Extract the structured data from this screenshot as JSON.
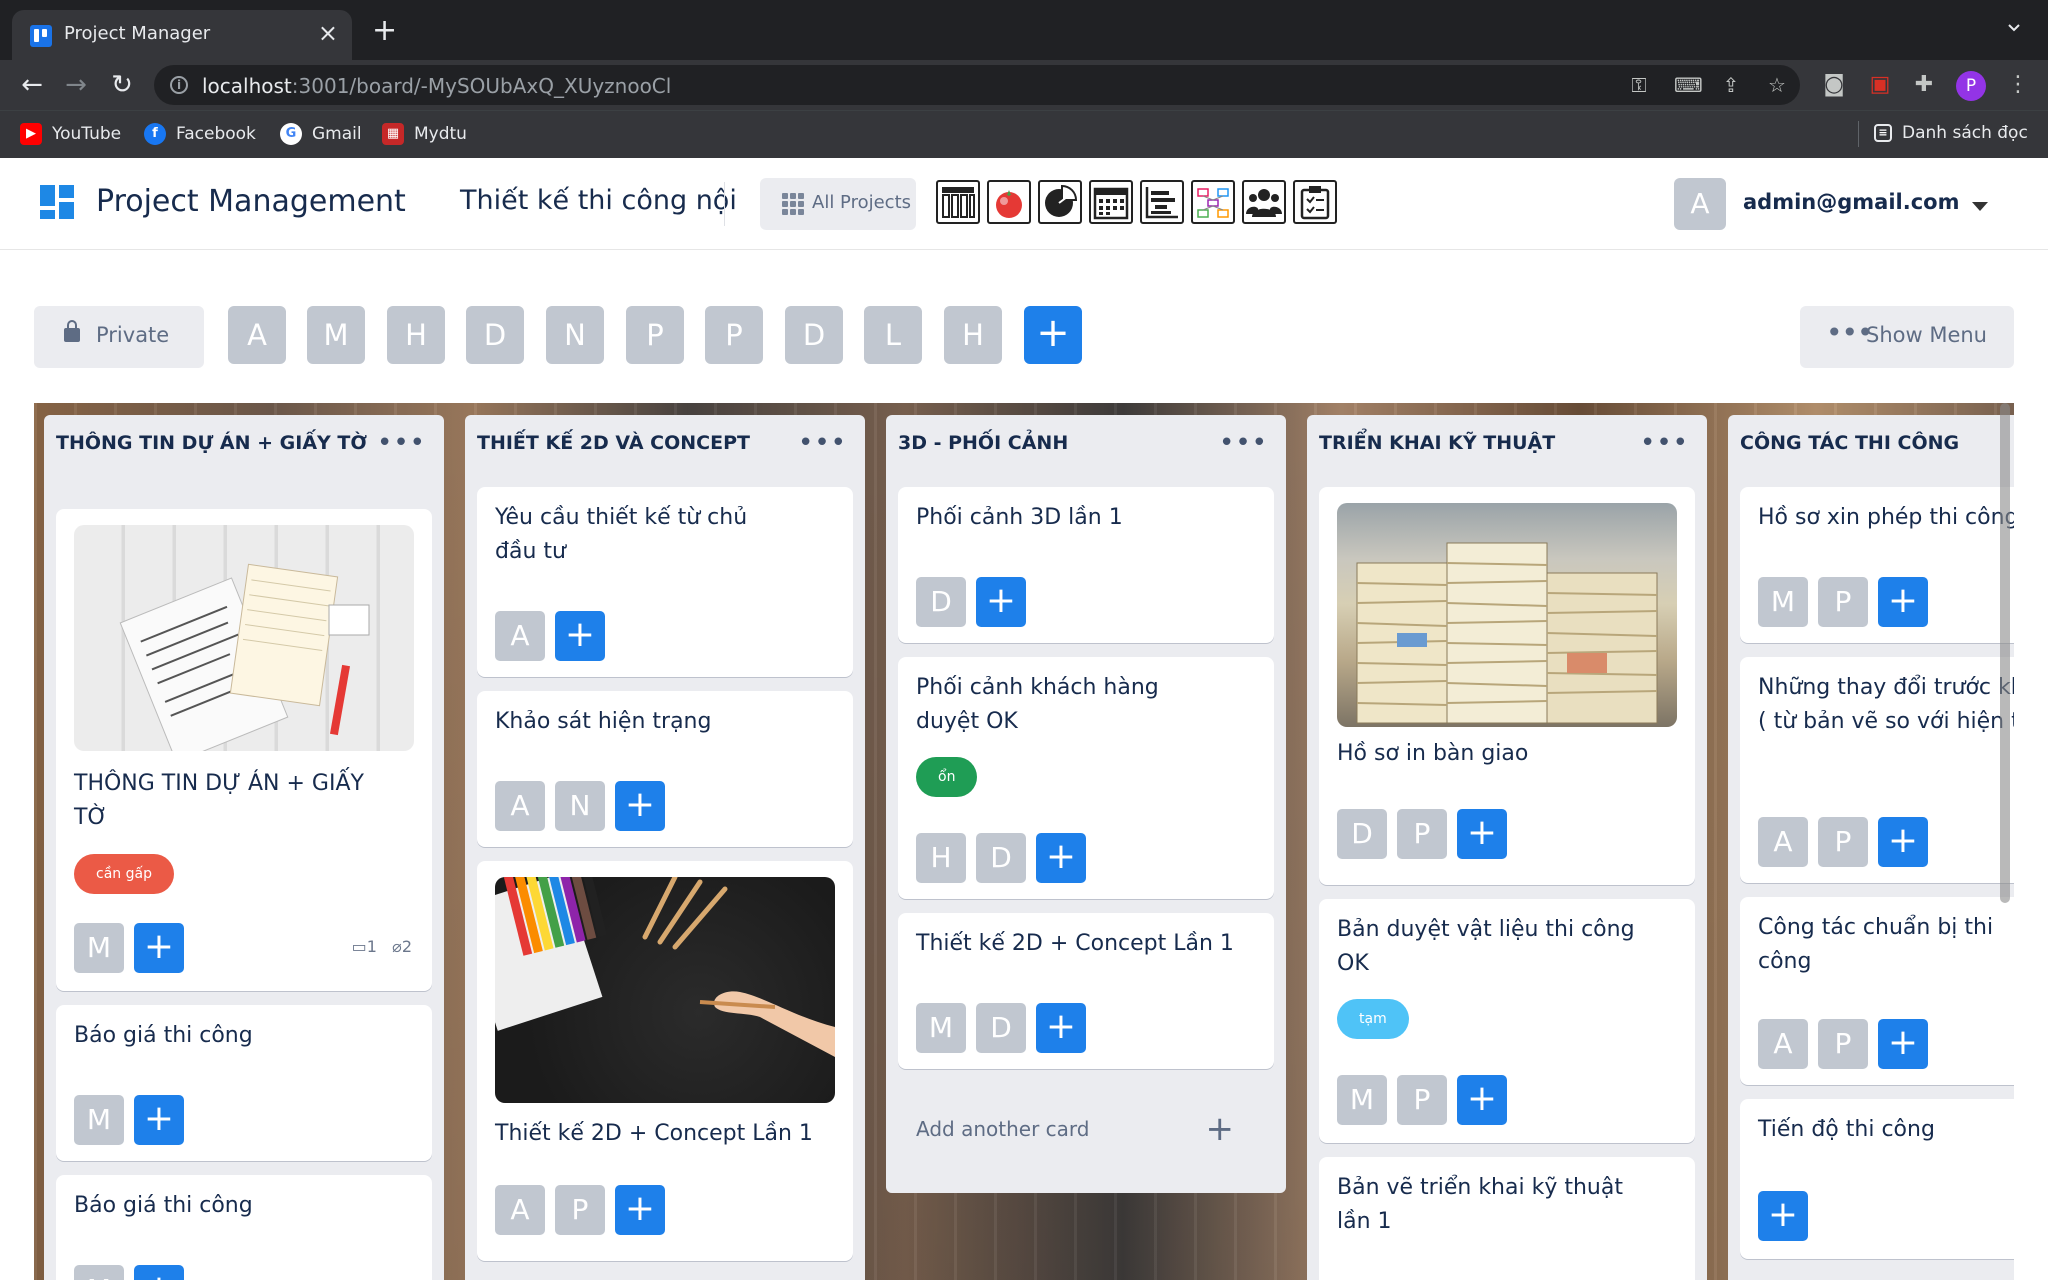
{
  "browser": {
    "tab_title": "Project Manager",
    "url_host": "localhost",
    "url_rest": ":3001/board/-MySOUbAxQ_XUyznooCl",
    "bookmarks": [
      "YouTube",
      "Facebook",
      "Gmail",
      "Mydtu"
    ],
    "reading_list": "Danh sách đọc",
    "profile_initial": "P"
  },
  "app": {
    "title": "Project Management",
    "board_name": "Thiết kế thi công nội",
    "all_projects": "All Projects",
    "user_initial": "A",
    "user_email": "admin@gmail.com"
  },
  "boardbar": {
    "private_label": "Private",
    "members": [
      "A",
      "M",
      "H",
      "D",
      "N",
      "P",
      "P",
      "D",
      "L",
      "H"
    ],
    "add_member": "+",
    "show_menu": "Show Menu"
  },
  "colors": {
    "accent": "#1e80ea",
    "label_red": "#eb5a46",
    "label_green": "#1f9d55",
    "label_cyan": "#4fc3f7"
  },
  "columns": [
    {
      "title": "THÔNG TIN DỰ ÁN + GIẤY TỜ",
      "cards": [
        {
          "title": "THÔNG TIN DỰ ÁN + GIẤY TỜ",
          "image": "documents",
          "label": "cần gấp",
          "members": [
            "M"
          ],
          "comments": "1",
          "attachments": "2"
        },
        {
          "title": "Báo giá thi công",
          "members": [
            "M"
          ]
        },
        {
          "title": "Báo giá thi công",
          "members": []
        }
      ]
    },
    {
      "title": "THIẾT KẾ 2D VÀ CONCEPT",
      "cards": [
        {
          "title": "Yêu cầu thiết kế từ chủ đầu tư",
          "members": [
            "A"
          ]
        },
        {
          "title": "Khảo sát hiện trạng",
          "members": [
            "A",
            "N"
          ]
        },
        {
          "title": "Thiết kế 2D + Concept Lần 1",
          "image": "pencils",
          "members": [
            "A",
            "P"
          ]
        }
      ]
    },
    {
      "title": "3D - PHỐI CẢNH",
      "cards": [
        {
          "title": "Phối cảnh 3D lần 1",
          "members": [
            "D"
          ]
        },
        {
          "title": "Phối cảnh khách hàng duyệt OK",
          "label": "ổn",
          "members": [
            "H",
            "D"
          ]
        },
        {
          "title": "Thiết kế 2D + Concept Lần 1",
          "members": [
            "M",
            "D"
          ]
        }
      ],
      "add_card": "Add another card"
    },
    {
      "title": "TRIỂN KHAI KỸ THUẬT",
      "cards": [
        {
          "title": "Hồ sơ in bàn giao",
          "image": "paper-stack",
          "members": [
            "D",
            "P"
          ]
        },
        {
          "title": "Bản duyệt vật liệu thi công OK",
          "label": "tạm",
          "members": [
            "M",
            "P"
          ]
        },
        {
          "title": "Bản vẽ triển khai kỹ thuật lần 1",
          "members": []
        }
      ]
    },
    {
      "title": "CÔNG TÁC THI CÔNG",
      "cards": [
        {
          "title": "Hồ sơ xin phép thi công",
          "members": [
            "M",
            "P"
          ]
        },
        {
          "title": "Những thay đổi trước khi thi công ( từ bản vẽ so với hiện trạng)",
          "members": [
            "A",
            "P"
          ]
        },
        {
          "title": "Công tác chuẩn bị thi công",
          "members": [
            "A",
            "P"
          ]
        },
        {
          "title": "Tiến độ thi công",
          "members": []
        }
      ]
    }
  ]
}
